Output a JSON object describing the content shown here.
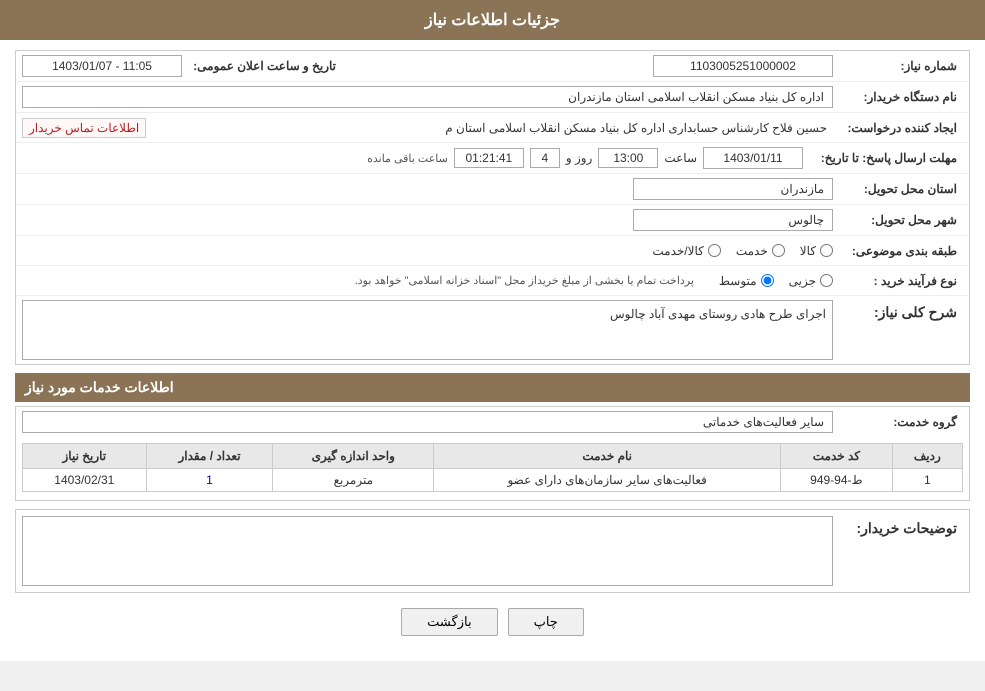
{
  "page": {
    "header": "جزئیات اطلاعات نیاز",
    "sections": {
      "info": {
        "shomareNiaz_label": "شماره نیاز:",
        "shomareNiaz_value": "1103005251000002",
        "namDastgah_label": "نام دستگاه خریدار:",
        "namDastgah_value": "اداره کل بنیاد مسکن انقلاب اسلامی استان مازندران",
        "tarikhAlanLabel": "تاریخ و ساعت اعلان عمومی:",
        "tarikhAlan_value": "1403/01/07 - 11:05",
        "ijadKonande_label": "ایجاد کننده درخواست:",
        "ijadKonande_value": "حسین فلاح کارشناس حسابداری اداره کل بنیاد مسکن انقلاب اسلامی استان م",
        "ettelaat_link": "اطلاعات تماس خریدار",
        "mohlatErsalLabel": "مهلت ارسال پاسخ: تا تاریخ:",
        "mohlatDate": "1403/01/11",
        "mohlatSaat": "13:00",
        "mohlatRoz": "4",
        "mohlatSaatMande": "01:21:41",
        "saatBaqiMande_label": "ساعت باقی مانده",
        "ostanLabel": "استان محل تحویل:",
        "ostanValue": "مازندران",
        "shahrLabel": "شهر محل تحویل:",
        "shahrValue": "چالوس",
        "tabaqehBandiLabel": "طبقه بندی موضوعی:",
        "kala": "کالا",
        "khedmat": "خدمت",
        "kalaKhedmat": "کالا/خدمت",
        "noFarayandLabel": "نوع فرآیند خرید :",
        "jozei": "جزیی",
        "mottaset": "متوسط",
        "noFarayandNote": "پرداخت تمام یا بخشی از مبلغ خریداز محل \"اسناد خزانه اسلامی\" خواهد بود.",
        "sharhKolli_title": "شرح کلی نیاز:",
        "sharhKolli_value": "اجرای طرح هادی روستای مهدی آباد چالوس"
      },
      "khadamat": {
        "title": "اطلاعات خدمات مورد نیاز",
        "gorohKhedmat_label": "گروه خدمت:",
        "gorohKhedmat_value": "سایر فعالیت‌های خدماتی",
        "table": {
          "headers": [
            "ردیف",
            "کد خدمت",
            "نام خدمت",
            "واحد اندازه گیری",
            "تعداد / مقدار",
            "تاریخ نیاز"
          ],
          "rows": [
            {
              "radif": "1",
              "kodKhedmat": "ط-94-949",
              "namKhedmat": "فعالیت‌های سایر سازمان‌های دارای عضو",
              "vahed": "مترمربع",
              "tedad": "1",
              "tarikh": "1403/02/31"
            }
          ]
        }
      },
      "tawsihat": {
        "title": "توضیحات خریدار:",
        "value": ""
      }
    },
    "buttons": {
      "print": "چاپ",
      "back": "بازگشت"
    }
  }
}
